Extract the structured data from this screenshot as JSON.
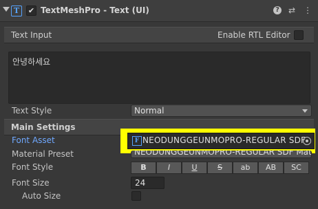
{
  "component": {
    "title": "TextMeshPro - Text (UI)",
    "icon": "tmp-text-component-icon",
    "enabled_mark": "✔",
    "header_icons": {
      "help": "?",
      "preset": "⇄",
      "menu": "⋮"
    }
  },
  "text_input": {
    "section_title": "Text Input",
    "rtl_label": "Enable RTL Editor",
    "value": "안녕하세요",
    "text_style_label": "Text Style",
    "text_style_value": "Normal"
  },
  "main_settings": {
    "section_title": "Main Settings",
    "font_asset_label": "Font Asset",
    "font_asset_value": "NEODUNGGEUNMOPRO-REGULAR SDF",
    "material_preset_label": "Material Preset",
    "material_preset_value": "NEODUNGGEUNMOPRO-REGULAR SDF Materi",
    "font_style_label": "Font Style",
    "font_style_buttons": [
      "B",
      "I",
      "U",
      "S",
      "ab",
      "AB",
      "SC"
    ],
    "font_size_label": "Font Size",
    "font_size_value": "24",
    "auto_size_label": "Auto Size"
  },
  "colors": {
    "highlight": "#ffff00",
    "accent_label": "#6fa8ff",
    "icon_blue": "#56a3ff"
  }
}
